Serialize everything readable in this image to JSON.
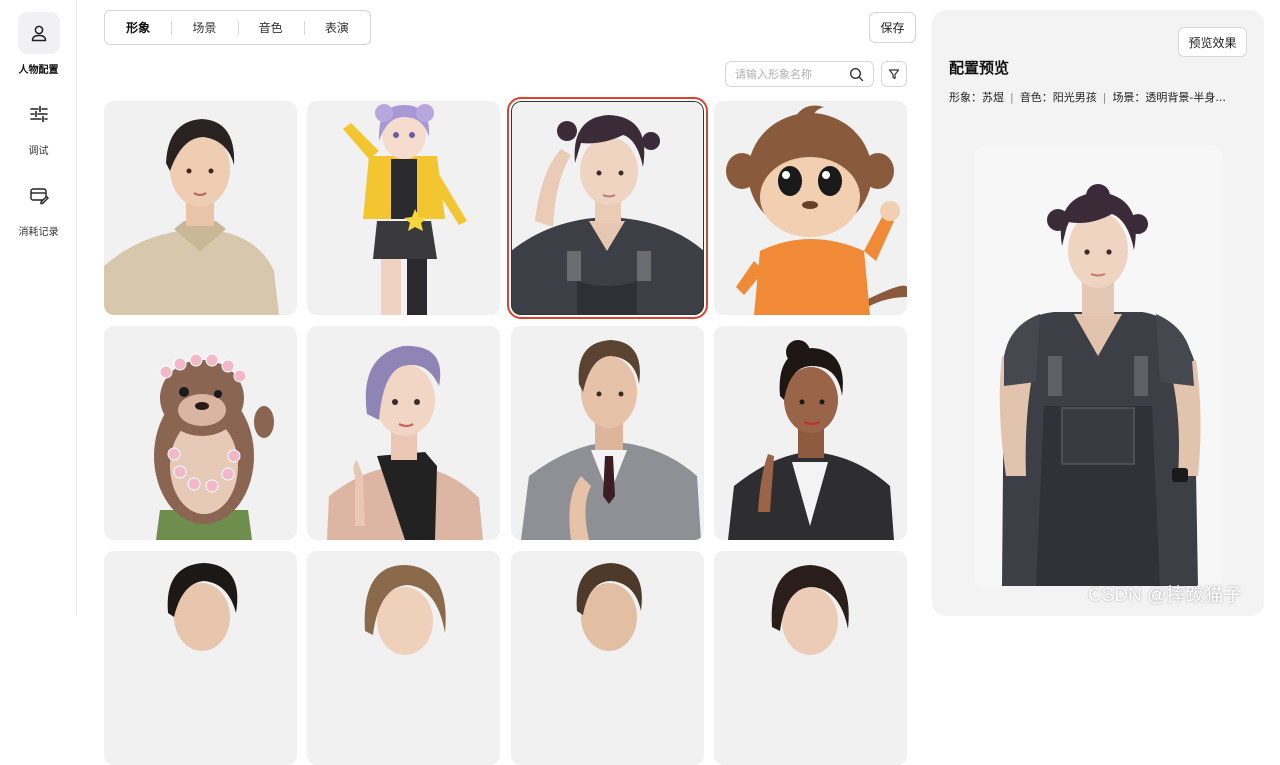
{
  "sidebar": {
    "items": [
      {
        "label": "人物配置",
        "icon": "person-icon",
        "active": true
      },
      {
        "label": "调试",
        "icon": "sliders-icon",
        "active": false
      },
      {
        "label": "消耗记录",
        "icon": "card-edit-icon",
        "active": false
      }
    ]
  },
  "tabs": [
    {
      "label": "形象",
      "active": true
    },
    {
      "label": "场景",
      "active": false
    },
    {
      "label": "音色",
      "active": false
    },
    {
      "label": "表演",
      "active": false
    }
  ],
  "toolbar": {
    "save_label": "保存"
  },
  "search": {
    "placeholder": "请输入形象名称",
    "value": ""
  },
  "avatars": [
    {
      "id": "woman-short-hair",
      "selected": false
    },
    {
      "id": "anime-girl",
      "selected": false
    },
    {
      "id": "curly-young-man",
      "selected": true
    },
    {
      "id": "cartoon-monkey",
      "selected": false
    },
    {
      "id": "cartoon-otter",
      "selected": false
    },
    {
      "id": "purple-hair-woman",
      "selected": false
    },
    {
      "id": "suit-man",
      "selected": false
    },
    {
      "id": "leather-jacket-woman",
      "selected": false
    },
    {
      "id": "man-row3",
      "selected": false
    },
    {
      "id": "woman-row3-a",
      "selected": false
    },
    {
      "id": "man-row3-b",
      "selected": false
    },
    {
      "id": "woman-row3-b",
      "selected": false
    }
  ],
  "preview": {
    "button_label": "预览效果",
    "title": "配置预览",
    "avatar_label": "形象：苏煜",
    "voice_label": "音色：阳光男孩",
    "scene_label": "场景：透明背景-半身..."
  },
  "watermark": "CSDN @摔跤猫子",
  "colors": {
    "selected_outline": "#d9432f",
    "card_bg": "#f1f1f2",
    "panel_bg": "#f3f3f4"
  }
}
